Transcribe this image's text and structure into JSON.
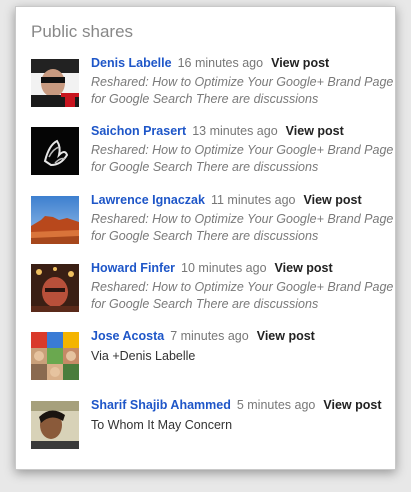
{
  "panel": {
    "title": "Public shares"
  },
  "shares": [
    {
      "name": "Denis Labelle",
      "time": "16 minutes ago",
      "view_label": "View post",
      "text": "Reshared: How to Optimize Your Google+ Brand Page for Google Search There are discussions",
      "avatar_icon": "person-photo-icon"
    },
    {
      "name": "Saichon Prasert",
      "time": "13 minutes ago",
      "view_label": "View post",
      "text": "Reshared: How to Optimize Your Google+ Brand Page for Google Search There are discussions",
      "avatar_icon": "hands-photo-icon"
    },
    {
      "name": "Lawrence Ignaczak",
      "time": "11 minutes ago",
      "view_label": "View post",
      "text": "Reshared: How to Optimize Your Google+ Brand Page for Google Search There are discussions",
      "avatar_icon": "landscape-photo-icon"
    },
    {
      "name": "Howard Finfer",
      "time": "10 minutes ago",
      "view_label": "View post",
      "text": "Reshared: How to Optimize Your Google+ Brand Page for Google Search There are discussions",
      "avatar_icon": "person-photo-icon"
    },
    {
      "name": "Jose Acosta",
      "time": "7 minutes ago",
      "view_label": "View post",
      "text": "Via +Denis Labelle",
      "avatar_icon": "collage-photo-icon"
    },
    {
      "name": "Sharif Shajib Ahammed",
      "time": "5 minutes ago",
      "view_label": "View post",
      "text": "To Whom It May Concern",
      "avatar_icon": "person-photo-icon"
    }
  ],
  "colors": {
    "name_link": "#1e56c8",
    "timestamp": "#777777",
    "reshare_text": "#7a7a7a"
  }
}
